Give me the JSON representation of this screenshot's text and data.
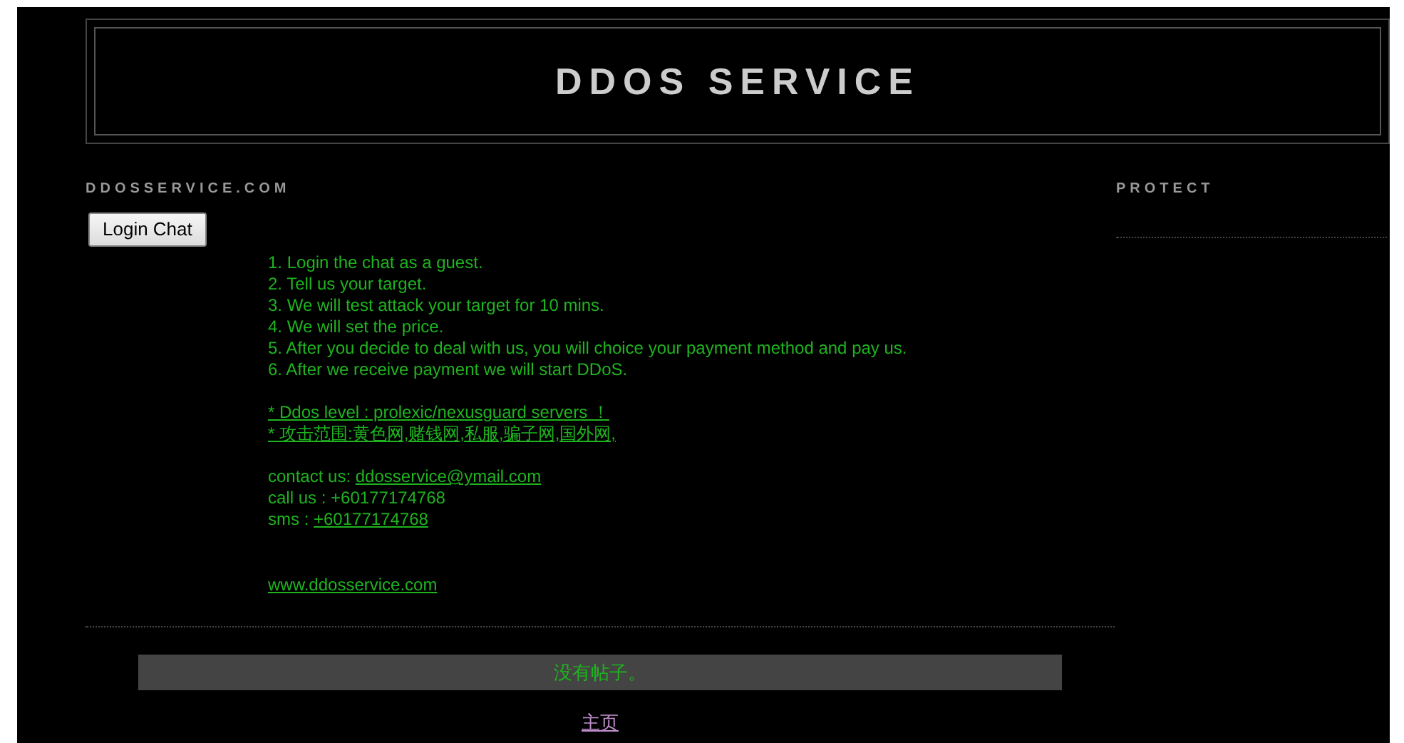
{
  "header": {
    "title": "DDOS SERVICE"
  },
  "main": {
    "heading": "DDOSSERVICE.COM",
    "button": "Login Chat",
    "steps": [
      "1. Login the chat as a guest.",
      "2. Tell us your target.",
      "3. We will test attack your target for 10 mins.",
      "4. We will set the price.",
      "5. After you decide to deal with us, you will choice your payment method and pay us.",
      "6. After we receive payment we will start DDoS."
    ],
    "notes": [
      "* Ddos level : prolexic/nexusguard servers ！",
      "* 攻击范围:黄色网,赌钱网,私服,骗子网,国外网,"
    ],
    "contacts": [
      {
        "label": "contact us: ",
        "value": "ddosservice@ymail.com",
        "link": true
      },
      {
        "label": "call us : ",
        "value": "+60177174768",
        "link": false
      },
      {
        "label": "sms : ",
        "value": "+60177174768",
        "link": true
      }
    ],
    "website": "www.ddosservice.com",
    "no_posts": "没有帖子。",
    "home_link": "主页"
  },
  "sidebar": {
    "heading": "PROTECT"
  }
}
